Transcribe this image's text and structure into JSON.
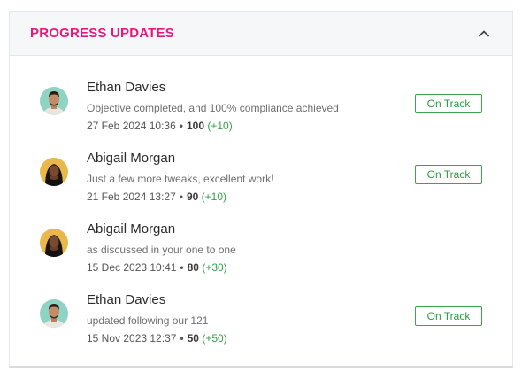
{
  "panel": {
    "title": "PROGRESS UPDATES",
    "collapse_icon": "chevron-up-icon"
  },
  "updates": [
    {
      "name": "Ethan Davies",
      "avatar": "avatar-ethan",
      "comment": "Objective completed, and 100% compliance achieved",
      "date": "27 Feb 2024 10:36",
      "score": "100",
      "delta": "(+10)",
      "status": "On Track"
    },
    {
      "name": "Abigail Morgan",
      "avatar": "avatar-abigail",
      "comment": "Just a few more tweaks, excellent work!",
      "date": "21 Feb 2024 13:27",
      "score": "90",
      "delta": "(+10)",
      "status": "On Track"
    },
    {
      "name": "Abigail Morgan",
      "avatar": "avatar-abigail",
      "comment": "as discussed in your one to one",
      "date": "15 Dec 2023 10:41",
      "score": "80",
      "delta": "(+30)",
      "status": ""
    },
    {
      "name": "Ethan Davies",
      "avatar": "avatar-ethan",
      "comment": "updated following our 121",
      "date": "15 Nov 2023 12:37",
      "score": "50",
      "delta": "(+50)",
      "status": "On Track"
    }
  ],
  "colors": {
    "title": "#e8177a",
    "status": "#3aa64c",
    "delta": "#33a24a"
  }
}
